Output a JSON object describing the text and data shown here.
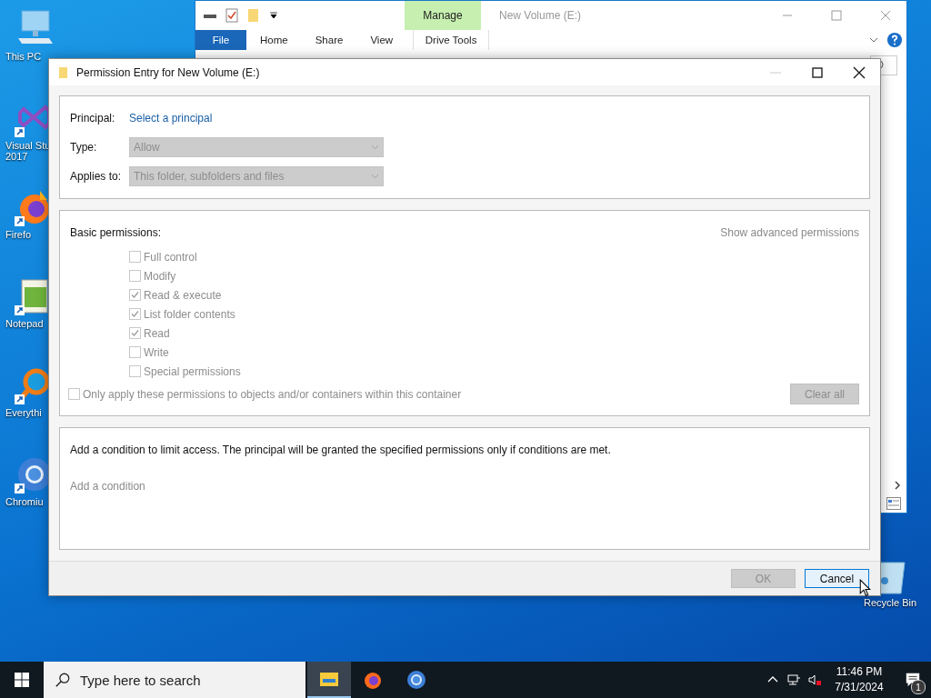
{
  "desktop_icons": [
    {
      "kind": "computer",
      "lines": [
        "This PC"
      ]
    },
    {
      "kind": "vs",
      "lines": [
        "Visual Stu",
        "2017"
      ]
    },
    {
      "kind": "firefox",
      "lines": [
        "Firefo"
      ]
    },
    {
      "kind": "notepad",
      "lines": [
        "Notepad"
      ]
    },
    {
      "kind": "everything",
      "lines": [
        "Everythi"
      ]
    },
    {
      "kind": "chromium",
      "lines": [
        "Chromiu"
      ]
    }
  ],
  "recycle_bin": {
    "label": "Recycle Bin"
  },
  "explorer": {
    "title": "New Volume (E:)",
    "context_group": "Manage",
    "tabs": [
      {
        "label": "File",
        "kind": "file"
      },
      {
        "label": "Home",
        "kind": "tab"
      },
      {
        "label": "Share",
        "kind": "tab"
      },
      {
        "label": "View",
        "kind": "tab"
      },
      {
        "label": "Drive Tools",
        "kind": "context"
      }
    ]
  },
  "dialog": {
    "title": "Permission Entry for New Volume (E:)",
    "principal": {
      "label": "Principal:",
      "link": "Select a principal"
    },
    "fields": [
      {
        "label": "Type:",
        "value": "Allow",
        "disabled": true
      },
      {
        "label": "Applies to:",
        "value": "This folder, subfolders and files",
        "disabled": true
      }
    ],
    "basic": {
      "heading": "Basic permissions:",
      "advanced_link": "Show advanced permissions",
      "permissions": [
        {
          "label": "Full control",
          "checked": false,
          "disabled": true
        },
        {
          "label": "Modify",
          "checked": false,
          "disabled": true
        },
        {
          "label": "Read & execute",
          "checked": true,
          "disabled": true
        },
        {
          "label": "List folder contents",
          "checked": true,
          "disabled": true
        },
        {
          "label": "Read",
          "checked": true,
          "disabled": true
        },
        {
          "label": "Write",
          "checked": false,
          "disabled": true
        },
        {
          "label": "Special permissions",
          "checked": false,
          "disabled": true
        }
      ],
      "only_apply": {
        "label": "Only apply these permissions to objects and/or containers within this container",
        "checked": false,
        "disabled": true
      },
      "clear_all": {
        "label": "Clear all",
        "disabled": true
      }
    },
    "condition": {
      "text": "Add a condition to limit access. The principal will be granted the specified permissions only if conditions are met.",
      "add_link": "Add a condition"
    },
    "buttons": [
      {
        "label": "OK",
        "disabled": true,
        "focused": false
      },
      {
        "label": "Cancel",
        "disabled": false,
        "focused": true
      }
    ]
  },
  "taskbar": {
    "search": {
      "placeholder": "Type here to search"
    },
    "apps": [
      {
        "kind": "explorer",
        "active": true
      },
      {
        "kind": "firefox",
        "active": false
      },
      {
        "kind": "chromium",
        "active": false
      }
    ],
    "time": "11:46 PM",
    "date": "7/31/2024",
    "notifications": "1"
  }
}
